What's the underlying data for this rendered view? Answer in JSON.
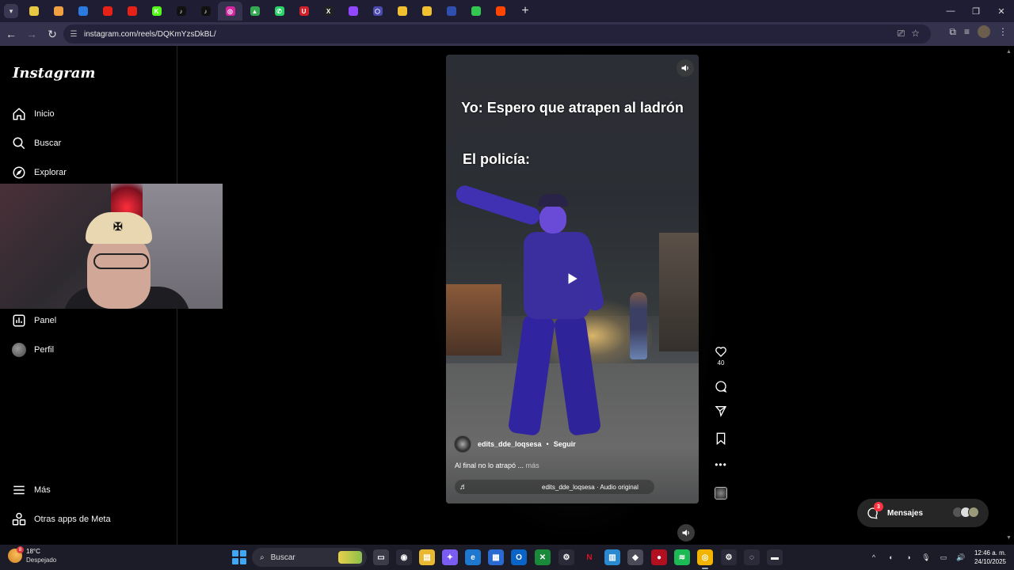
{
  "browser": {
    "tabs": [
      {
        "icon": "spreadsheet-icon",
        "color": "#e8c840",
        "glyph": ""
      },
      {
        "icon": "slides-icon",
        "color": "#f0a040",
        "glyph": ""
      },
      {
        "icon": "edge-icon",
        "color": "#2a7ae0",
        "glyph": ""
      },
      {
        "icon": "youtube-icon",
        "color": "#e62117",
        "glyph": ""
      },
      {
        "icon": "youtube-icon",
        "color": "#e62117",
        "glyph": ""
      },
      {
        "icon": "kick-icon",
        "color": "#53fc18",
        "glyph": "K"
      },
      {
        "icon": "tiktok-icon",
        "color": "#111111",
        "glyph": "♪"
      },
      {
        "icon": "tiktok-icon",
        "color": "#111111",
        "glyph": "♪"
      },
      {
        "icon": "instagram-icon",
        "color": "#d6249f",
        "glyph": "◎"
      },
      {
        "icon": "drive-icon",
        "color": "#34a853",
        "glyph": "▲"
      },
      {
        "icon": "whatsapp-icon",
        "color": "#25d366",
        "glyph": "✆"
      },
      {
        "icon": "u-icon",
        "color": "#d0202a",
        "glyph": "U"
      },
      {
        "icon": "x-icon",
        "color": "#222222",
        "glyph": "X"
      },
      {
        "icon": "twitch-icon",
        "color": "#9146ff",
        "glyph": ""
      },
      {
        "icon": "hex-icon",
        "color": "#4a4ab0",
        "glyph": "⬡"
      },
      {
        "icon": "character-icon",
        "color": "#f0c030",
        "glyph": ""
      },
      {
        "icon": "character-icon",
        "color": "#f0c030",
        "glyph": ""
      },
      {
        "icon": "glasses-icon",
        "color": "#3050b0",
        "glyph": ""
      },
      {
        "icon": "chat-icon",
        "color": "#32c850",
        "glyph": ""
      },
      {
        "icon": "reddit-icon",
        "color": "#ff4500",
        "glyph": ""
      }
    ],
    "active_tab_index": 8,
    "url": "instagram.com/reels/DQKmYzsDkBL/"
  },
  "instagram": {
    "logo": "Instagram",
    "nav": {
      "home": "Inicio",
      "search": "Buscar",
      "explore": "Explorar",
      "dashboard": "Panel",
      "profile": "Perfil",
      "more": "Más",
      "meta_apps": "Otras apps de Meta"
    },
    "reel": {
      "overlay_line1": "Yo: Espero que atrapen al ladrón",
      "overlay_line2": "El policía:",
      "username": "edits_dde_loqsesa",
      "separator": "•",
      "follow": "Seguir",
      "caption": "Al final no lo atrapó ...",
      "caption_more": "más",
      "audio": "edits_dde_loqsesa · Audio original",
      "likes": "40"
    },
    "messages": {
      "label": "Mensajes",
      "badge": "3"
    }
  },
  "taskbar": {
    "weather_temp": "18°C",
    "weather_condition": "Despejado",
    "weather_badge": "8",
    "search_label": "Buscar",
    "time": "12:46 a. m.",
    "date": "24/10/2025"
  }
}
